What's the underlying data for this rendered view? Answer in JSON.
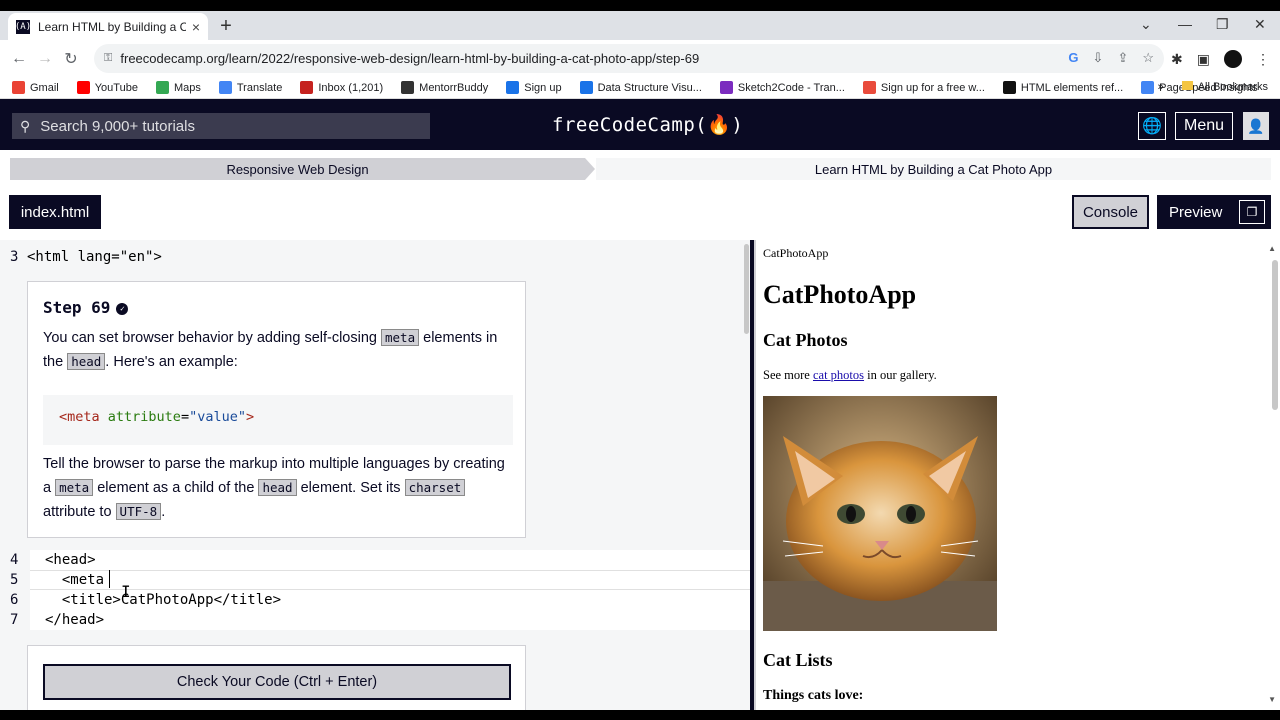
{
  "browser": {
    "tab_title": "Learn HTML by Building a Cat Ph",
    "favicon_text": "(A)",
    "url": "freecodecamp.org/learn/2022/responsive-web-design/learn-html-by-building-a-cat-photo-app/step-69",
    "bookmarks": [
      {
        "label": "Gmail",
        "color": "#ea4335"
      },
      {
        "label": "YouTube",
        "color": "#ff0000"
      },
      {
        "label": "Maps",
        "color": "#34a853"
      },
      {
        "label": "Translate",
        "color": "#4285f4"
      },
      {
        "label": "Inbox (1,201)",
        "color": "#c5221f"
      },
      {
        "label": "MentorrBuddy",
        "color": "#333333"
      },
      {
        "label": "Sign up",
        "color": "#1a73e8"
      },
      {
        "label": "Data Structure Visu...",
        "color": "#1a73e8"
      },
      {
        "label": "Sketch2Code - Tran...",
        "color": "#7b2cbf"
      },
      {
        "label": "Sign up for a free w...",
        "color": "#e94b3c"
      },
      {
        "label": "HTML elements ref...",
        "color": "#111111"
      },
      {
        "label": "PageSpeed Insights",
        "color": "#4285f4"
      }
    ],
    "bookmarks_overflow": "»",
    "all_bookmarks": "All Bookmarks"
  },
  "header": {
    "search_placeholder": "Search 9,000+ tutorials",
    "logo": "freeCodeCamp(🔥)",
    "menu_label": "Menu"
  },
  "breadcrumb": {
    "course": "Responsive Web Design",
    "project": "Learn HTML by Building a Cat Photo App"
  },
  "toolbar": {
    "file_tab": "index.html",
    "console_label": "Console",
    "preview_label": "Preview"
  },
  "editor": {
    "line_numbers": [
      "3",
      "4",
      "5",
      "6",
      "7"
    ],
    "line3": "<html lang=\"en\">",
    "line4": "<head>",
    "line5": "  <meta",
    "line6": "  <title>CatPhotoApp</title>",
    "line7": "</head>"
  },
  "instructions": {
    "step_label": "Step 69",
    "p1_a": "You can set browser behavior by adding self-closing ",
    "p1_code1": "meta",
    "p1_b": " elements in the ",
    "p1_code2": "head",
    "p1_c": ". Here's an example:",
    "example_tag_open": "<meta ",
    "example_attr": "attribute",
    "example_eq": "=",
    "example_value": "\"value\"",
    "example_tag_close": ">",
    "p2_a": "Tell the browser to parse the markup into multiple languages by creating a ",
    "p2_code1": "meta",
    "p2_b": " element as a child of the ",
    "p2_code2": "head",
    "p2_c": " element. Set its ",
    "p2_code3": "charset",
    "p2_d": " attribute to ",
    "p2_code4": "UTF-8",
    "p2_e": "."
  },
  "check_button": "Check Your Code (Ctrl + Enter)",
  "preview": {
    "page_title": "CatPhotoApp",
    "h1": "CatPhotoApp",
    "h2": "Cat Photos",
    "p_a": "See more ",
    "p_link": "cat photos",
    "p_b": " in our gallery.",
    "h2b": "Cat Lists",
    "h3": "Things cats love:"
  }
}
